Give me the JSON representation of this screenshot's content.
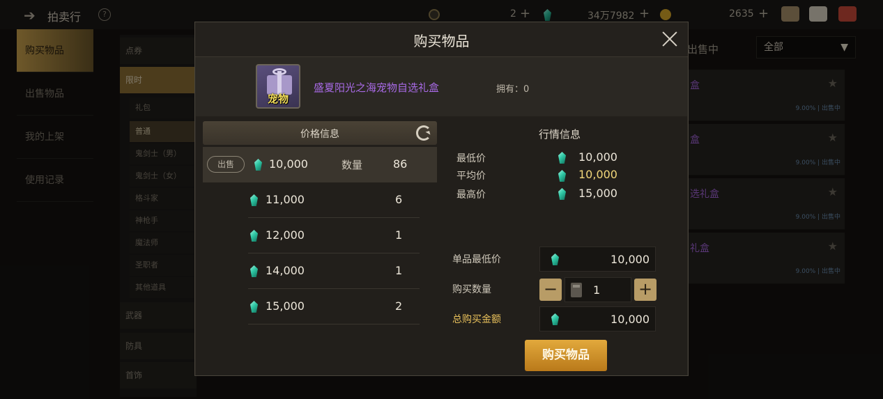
{
  "background": {
    "top_title": "拍卖行",
    "top_values": [
      "2",
      "34万7982",
      "2635"
    ],
    "left_nav": [
      "购买物品",
      "出售物品",
      "我的上架",
      "使用记录"
    ],
    "categories": [
      "点券",
      "限时",
      "武器",
      "防具",
      "首饰"
    ],
    "subcats": [
      "礼包",
      "普通",
      "鬼剑士（男）",
      "鬼剑士（女）",
      "格斗家",
      "神枪手",
      "魔法师",
      "圣职者",
      "其他道具"
    ],
    "filter_label": "出售中",
    "filter_select": "全部",
    "list_rows": [
      {
        "name": "盒",
        "meta": "9.00% | 出售中"
      },
      {
        "name": "盒",
        "meta": "9.00% | 出售中"
      },
      {
        "name": "选礼盒",
        "meta": "9.00% | 出售中"
      },
      {
        "name": "礼盒",
        "meta": "9.00% | 出售中"
      }
    ]
  },
  "modal": {
    "title": "购买物品",
    "item": {
      "tag": "宠物",
      "name": "盛夏阳光之海宠物自选礼盒",
      "owned": "拥有：0"
    },
    "price_info": {
      "header": "价格信息",
      "sell_tag": "出售",
      "qty_label": "数量",
      "rows": [
        {
          "price": "10,000",
          "qty": "86"
        },
        {
          "price": "11,000",
          "qty": "6"
        },
        {
          "price": "12,000",
          "qty": "1"
        },
        {
          "price": "14,000",
          "qty": "1"
        },
        {
          "price": "15,000",
          "qty": "2"
        }
      ]
    },
    "market_info": {
      "header": "行情信息",
      "min_label": "最低价",
      "min_value": "10,000",
      "avg_label": "平均价",
      "avg_value": "10,000",
      "max_label": "最高价",
      "max_value": "15,000"
    },
    "form": {
      "unit_min_label": "单品最低价",
      "unit_min_value": "10,000",
      "qty_label": "购买数量",
      "qty_value": "1",
      "total_label": "总购买金额",
      "total_value": "10,000",
      "minus": "−",
      "plus": "+"
    },
    "buy_button": "购买物品"
  },
  "colors": {
    "accent_gold": "#e2a93c",
    "item_purple": "#a86ae6",
    "gem_teal": "#2fc7a4"
  }
}
